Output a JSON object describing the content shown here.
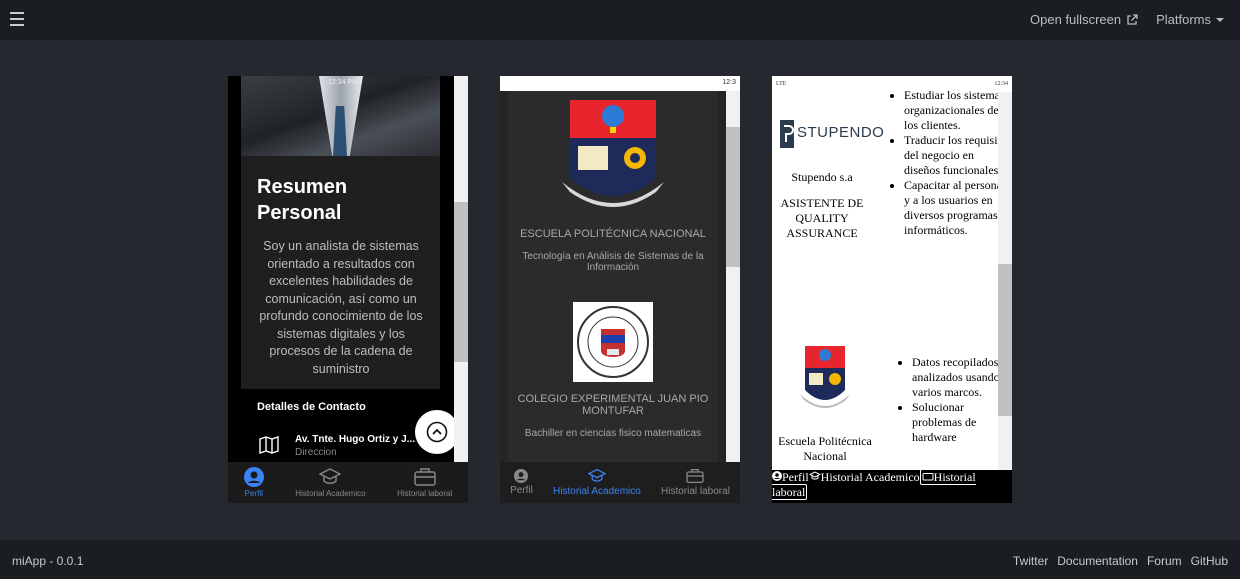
{
  "topbar": {
    "fullscreen_label": "Open fullscreen",
    "platforms_label": "Platforms"
  },
  "footer": {
    "version": "miApp - 0.0.1",
    "links": [
      "Twitter",
      "Documentation",
      "Forum",
      "GitHub"
    ]
  },
  "phone1": {
    "status_time": "12:34 PM",
    "title": "Resumen Personal",
    "summary": "Soy un analista de sistemas orientado a resultados con excelentes habilidades de comunicación, así como un profundo conocimiento de los sistemas digitales y los procesos de la cadena de suministro",
    "contact_heading": "Detalles de Contacto",
    "address": "Av. Tnte. Hugo Ortiz y J...",
    "address_label": "Direccion",
    "tabs": [
      "Perfil",
      "Historial Academico",
      "Historial laboral"
    ]
  },
  "phone2": {
    "status_time": "12:3",
    "school1": "ESCUELA POLITÉCNICA NACIONAL",
    "degree1": "Tecnología en Análisis de Sistemas de la Información",
    "school2": "COLEGIO EXPERIMENTAL JUAN PIO MONTUFAR",
    "degree2": "Bachiller en ciencias fisico matematicas",
    "tabs": [
      "Perfil",
      "Historial Academico",
      "Historial laboral"
    ]
  },
  "phone3": {
    "status_left": "LTE",
    "status_time": "12:34",
    "logo_text": "STUPENDO",
    "company": "Stupendo s.a",
    "role": "ASISTENTE DE QUALITY ASSURANCE",
    "duties1": [
      "Estudiar los sistemas organizacionales de los clientes.",
      "Traducir los requisitos del negocio en diseños funcionales",
      "Capacitar al personal y a los usuarios en diversos programas informáticos."
    ],
    "duties2": [
      "Datos recopilados y analizados usando varios marcos.",
      "Solucionar problemas de hardware"
    ],
    "school": "Escuela Politécnica Nacional",
    "tabs": [
      "Perfil",
      "Historial Academico",
      "Historial laboral"
    ]
  },
  "colors": {
    "accent": "#3b82f6",
    "background": "#25282e",
    "bar": "#1a1d22"
  }
}
